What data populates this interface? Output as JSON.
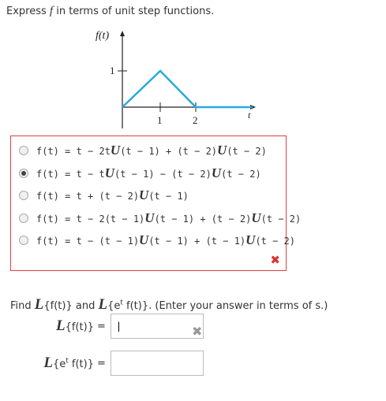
{
  "prompt": {
    "text_before": "Express ",
    "var": "f",
    "text_after": " in terms of unit step functions."
  },
  "graph": {
    "y_label": "f(t)",
    "y_tick": "1",
    "x_ticks": [
      "1",
      "2"
    ],
    "x_label": "t",
    "line_color": "#29a9e1"
  },
  "choices": [
    {
      "parts": [
        "f(t) = t − 2t",
        "U",
        "(t − 1) + (t − 2)",
        "U",
        "(t − 2)"
      ],
      "selected": false
    },
    {
      "parts": [
        "f(t) = t − t",
        "U",
        "(t − 1) − (t − 2)",
        "U",
        "(t − 2)"
      ],
      "selected": true
    },
    {
      "parts": [
        "f(t) = t + (t − 2)",
        "U",
        "(t − 1)",
        "",
        ""
      ],
      "selected": false
    },
    {
      "parts": [
        "f(t) = t − 2(t − 1)",
        "U",
        "(t − 1) + (t − 2)",
        "U",
        "(t − 2)"
      ],
      "selected": false
    },
    {
      "parts": [
        "f(t) = t − (t − 1)",
        "U",
        "(t − 1) + (t − 1)",
        "U",
        "(t − 2)"
      ],
      "selected": false
    }
  ],
  "incorrect_mark": "✖",
  "find": {
    "text1": "Find ",
    "L": "L",
    "text2": "{f(t)} and ",
    "text3": "{e",
    "sup": "t",
    "text4": " f(t)}. (Enter your answer in terms of s.)"
  },
  "answers": {
    "row1": {
      "label": "{f(t)}",
      "eq": "=",
      "value": "|"
    },
    "row2": {
      "label_a": "{e",
      "label_sup": "t",
      "label_b": " f(t)}",
      "eq": "=",
      "value": ""
    },
    "clear_mark": "✖"
  }
}
